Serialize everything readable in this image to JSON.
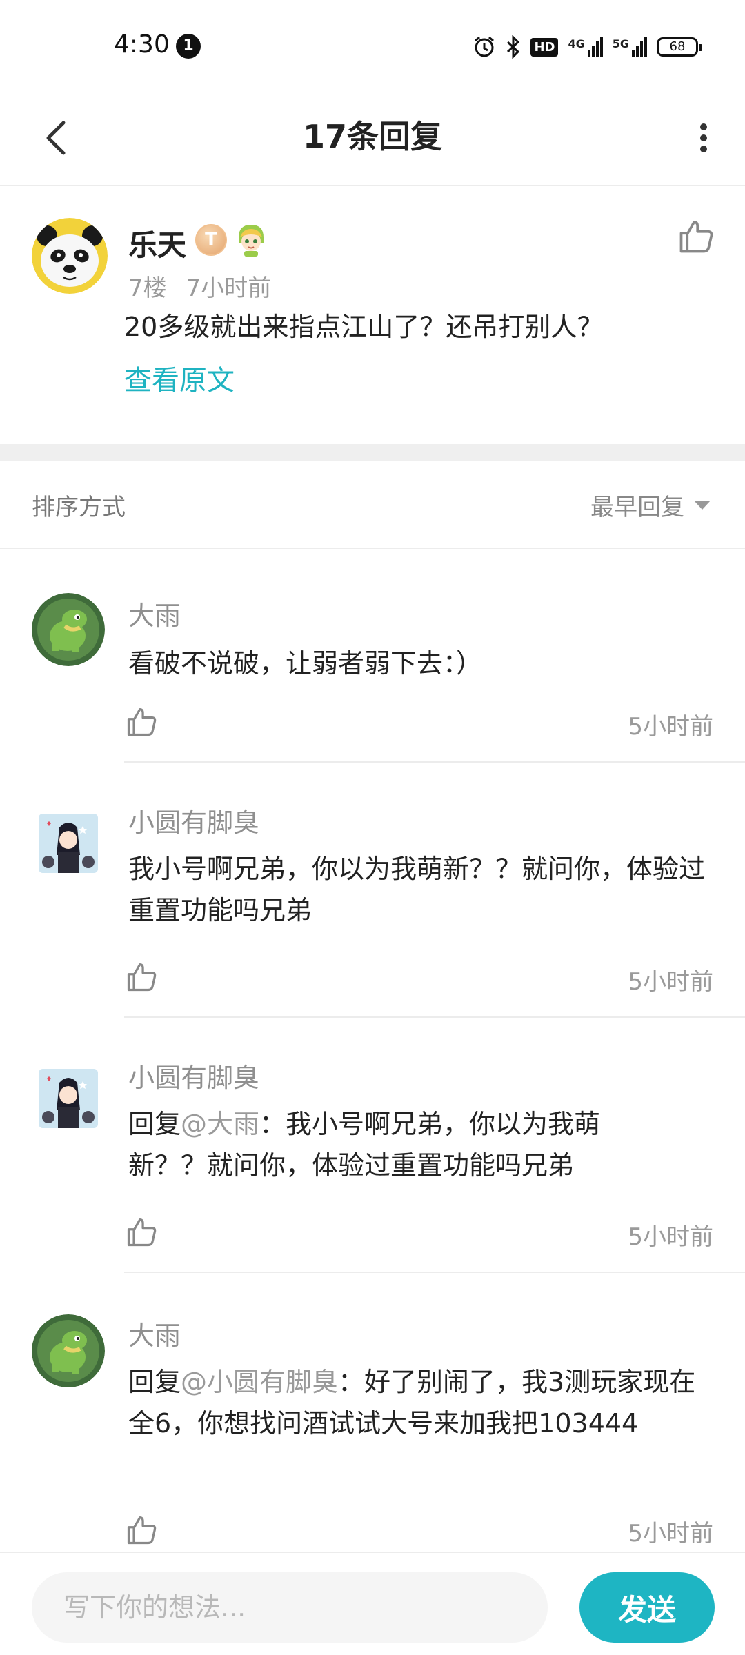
{
  "status_bar": {
    "time": "4:30",
    "notification_count": "1",
    "hd_label": "HD",
    "signal1_label": "4G",
    "signal2_label": "5G",
    "battery": "68"
  },
  "header": {
    "title": "17条回复"
  },
  "main_post": {
    "author": "乐天",
    "badge": "T",
    "floor": "7楼",
    "time": "7小时前",
    "text": "20多级就出来指点江山了？还吊打别人？",
    "view_original": "查看原文"
  },
  "sort": {
    "label": "排序方式",
    "selected": "最早回复"
  },
  "replies": [
    {
      "name": "大雨",
      "prefix": "",
      "mention": "",
      "text": "看破不说破，让弱者弱下去：）",
      "time": "5小时前"
    },
    {
      "name": "小圆有脚臭",
      "prefix": "",
      "mention": "",
      "text": "我小号啊兄弟，你以为我萌新？？就问你，体验过重置功能吗兄弟",
      "time": "5小时前"
    },
    {
      "name": "小圆有脚臭",
      "prefix": "回复",
      "mention": "@大雨",
      "text": "：我小号啊兄弟，你以为我萌新？？就问你，体验过重置功能吗兄弟",
      "time": "5小时前"
    },
    {
      "name": "大雨",
      "prefix": "回复",
      "mention": "@小圆有脚臭",
      "text": "：好了别闹了，我3测玩家现在全6，你想找问酒试试大号来加我把103444",
      "time": "5小时前"
    }
  ],
  "composer": {
    "placeholder": "写下你的想法...",
    "send_label": "发送"
  },
  "colors": {
    "accent": "#1eb5c3",
    "link": "#1fb3c1"
  }
}
